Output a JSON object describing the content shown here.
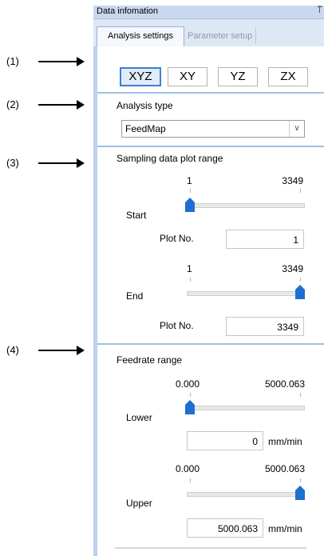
{
  "callouts": [
    "(1)",
    "(2)",
    "(3)",
    "(4)"
  ],
  "panel": {
    "title": "Data infomation",
    "pin": "⍑",
    "tabs": [
      {
        "label": "Analysis settings",
        "active": true
      },
      {
        "label": "Parameter setup",
        "active": false
      }
    ]
  },
  "view_buttons": [
    {
      "label": "XYZ",
      "selected": true
    },
    {
      "label": "XY",
      "selected": false
    },
    {
      "label": "YZ",
      "selected": false
    },
    {
      "label": "ZX",
      "selected": false
    }
  ],
  "analysis_type": {
    "heading": "Analysis type",
    "value": "FeedMap",
    "arrow": "∨"
  },
  "sampling": {
    "heading": "Sampling data plot range",
    "start": {
      "label": "Start",
      "min": "1",
      "max": "3349",
      "slider_position": 0,
      "field_label": "Plot No.",
      "value": "1"
    },
    "end": {
      "label": "End",
      "min": "1",
      "max": "3349",
      "slider_position": 1,
      "field_label": "Plot No.",
      "value": "3349"
    }
  },
  "feedrate": {
    "heading": "Feedrate range",
    "lower": {
      "label": "Lower",
      "min": "0.000",
      "max": "5000.063",
      "slider_position": 0,
      "value": "0",
      "unit": "mm/min"
    },
    "upper": {
      "label": "Upper",
      "min": "0.000",
      "max": "5000.063",
      "slider_position": 1,
      "value": "5000.063",
      "unit": "mm/min"
    }
  },
  "colors": {
    "accent": "#3d7fd0",
    "thumb": "#1f6fd1",
    "separator": "#9ebfe8",
    "titlebar": "#c9d8ee"
  }
}
